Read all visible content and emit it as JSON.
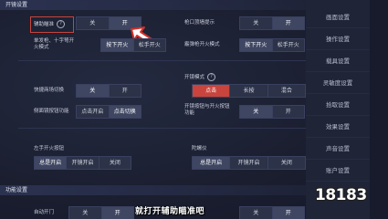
{
  "sections": {
    "fire_header": "开镜设置",
    "assist_header": "功能设置"
  },
  "sidebar": {
    "items": [
      "画面设置",
      "操作设置",
      "载具设置",
      "灵敏度设置",
      "拾取设置",
      "效果设置",
      "声音设置",
      "账户设置"
    ]
  },
  "settings": {
    "aim_assist": {
      "label": "辅助瞄准",
      "help": "?",
      "options": [
        "关",
        "开"
      ],
      "selected": 1
    },
    "muzzle_hint": {
      "label": "枪口顶墙提示",
      "options": [
        "关",
        "开"
      ],
      "selected": 1
    },
    "single_shot": {
      "label": "单发枪、十字弩开火模式",
      "options": [
        "按下开火",
        "松手开火"
      ],
      "selected": 0
    },
    "sniper_fire": {
      "label": "霰弹枪开火模式",
      "options": [
        "按下开火",
        "松手开火"
      ],
      "selected": 0
    },
    "quick_swap": {
      "label": "快捷商场切换",
      "options": [
        "关",
        "开"
      ],
      "selected": 0
    },
    "scope_mode": {
      "label": "开镜模式",
      "help": "?",
      "options": [
        "点击",
        "长按",
        "混合"
      ],
      "selected": 0
    },
    "peek_scope": {
      "label": "侧面镜按钮功能",
      "options": [
        "点击开启",
        "点击切换"
      ],
      "selected": 1
    },
    "scope_button": {
      "label": "开镜按钮与开火按钮功能",
      "options": [
        "关",
        "开"
      ],
      "selected": 0
    },
    "left_fire": {
      "label": "左手开火按钮",
      "options": [
        "总是开启",
        "开镜开启",
        "关闭"
      ],
      "selected": 0
    },
    "peek": {
      "label": "陀螺仪",
      "options": [
        "总是开启",
        "开镜开启",
        "关闭"
      ],
      "selected": 0
    },
    "auto_door": {
      "label": "自动开门",
      "options": [
        "关",
        "开"
      ],
      "selected": 1
    }
  },
  "caption": "就打开辅助瞄准吧",
  "watermark": "18183"
}
